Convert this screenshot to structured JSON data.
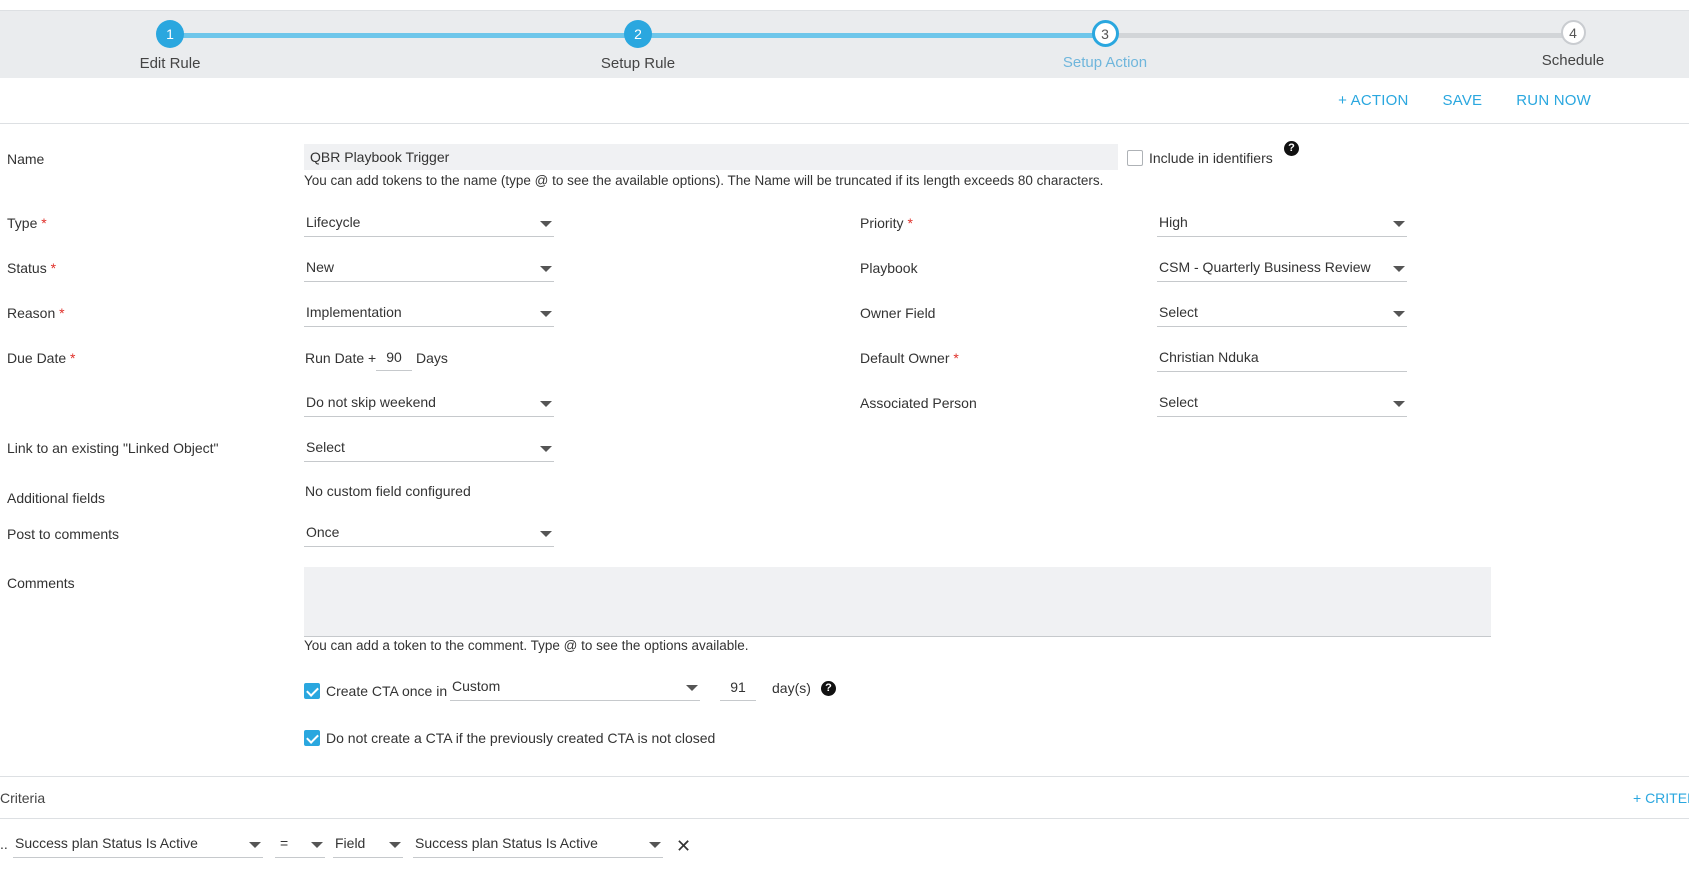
{
  "stepper": {
    "steps": [
      {
        "number": "1",
        "label": "Edit Rule",
        "state": "done"
      },
      {
        "number": "2",
        "label": "Setup Rule",
        "state": "done"
      },
      {
        "number": "3",
        "label": "Setup Action",
        "state": "current"
      },
      {
        "number": "4",
        "label": "Schedule",
        "state": "todo"
      }
    ]
  },
  "toolbar": {
    "add_action": "+ ACTION",
    "save": "SAVE",
    "run_now": "RUN NOW"
  },
  "form": {
    "name": {
      "label": "Name",
      "value": "QBR Playbook Trigger",
      "hint": "You can add tokens to the name (type @ to see the available options). The Name will be truncated if its length exceeds 80 characters.",
      "include_identifiers": "Include in identifiers"
    },
    "type": {
      "label": "Type",
      "value": "Lifecycle"
    },
    "status": {
      "label": "Status",
      "value": "New"
    },
    "reason": {
      "label": "Reason",
      "value": "Implementation"
    },
    "due_date": {
      "label": "Due Date",
      "prefix": "Run Date +",
      "days": "90",
      "suffix": "Days",
      "weekend": "Do not skip weekend"
    },
    "priority": {
      "label": "Priority",
      "value": "High"
    },
    "playbook": {
      "label": "Playbook",
      "value": "CSM - Quarterly Business Review"
    },
    "owner_field": {
      "label": "Owner Field",
      "value": "Select"
    },
    "default_owner": {
      "label": "Default Owner",
      "value": "Christian Nduka"
    },
    "associated_person": {
      "label": "Associated Person",
      "value": "Select"
    },
    "linked_object": {
      "label": "Link to an existing \"Linked Object\"",
      "value": "Select"
    },
    "additional_fields": {
      "label": "Additional fields",
      "value": "No custom field configured"
    },
    "post_to_comments": {
      "label": "Post to comments",
      "value": "Once"
    },
    "comments": {
      "label": "Comments",
      "hint": "You can add a token to the comment. Type @ to see the options available."
    },
    "required_mark": "*",
    "create_cta": {
      "label": "Create CTA once in",
      "frequency": "Custom",
      "days": "91",
      "unit": "day(s)",
      "checked": true
    },
    "no_duplicate": {
      "label": "Do not create a CTA if the previously created CTA is not closed",
      "checked": true
    }
  },
  "criteria": {
    "title": "Criteria",
    "add_label": "+ CRITERIA",
    "row": {
      "prefix": "..",
      "field": "Success plan Status Is Active",
      "operator": "=",
      "type": "Field",
      "value": "Success plan Status Is Active"
    }
  },
  "icons": {
    "help": "question-circle-icon",
    "close": "close-icon",
    "caret": "chevron-down-icon"
  },
  "colors": {
    "accent": "#2aa7df",
    "required": "#e0302a"
  }
}
